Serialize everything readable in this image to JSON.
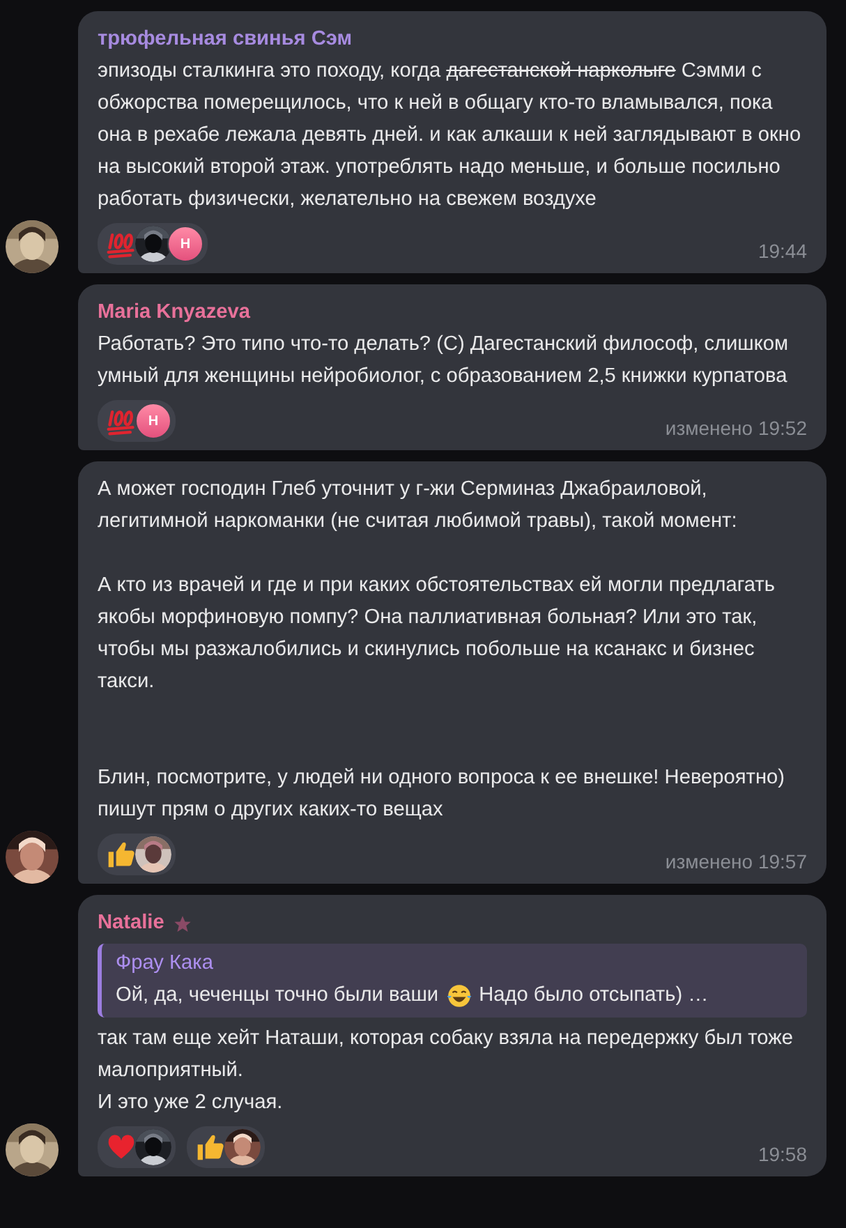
{
  "messages": [
    {
      "author": {
        "name": "трюфельная свинья Сэм",
        "color": "#a78be0",
        "premium": false
      },
      "avatar": {
        "kind": "picture"
      },
      "body": [
        {
          "text": "эпизоды сталкинга это походу, когда ",
          "struck": false
        },
        {
          "text": "дагестанской нарколыге",
          "struck": true
        },
        {
          "text": " Сэмми с обжорства померещилось, что к ней в общагу кто-то вламывался, пока она в рехабе лежала девять дней. и как алкаши к ней заглядывают в окно на высокий второй этаж. употреблять надо меньше, и больше посильно работать физически, желательно на свежем воздухе",
          "struck": false
        }
      ],
      "reactions": [
        {
          "kind": "hundred",
          "avatars": [
            {
              "kind": "picture"
            },
            {
              "kind": "initial",
              "text": "Н"
            }
          ]
        }
      ],
      "time": "19:44"
    },
    {
      "author": {
        "name": "Maria Knyazeva",
        "color": "#e8719a",
        "premium": false
      },
      "body": [
        {
          "text": "Работать? Это типо что-то делать? (С) Дагестанский философ, слишком умный для женщины нейробиолог, с образованием 2,5 книжки курпатова",
          "struck": false
        }
      ],
      "reactions": [
        {
          "kind": "hundred",
          "avatars": [
            {
              "kind": "initial",
              "text": "Н"
            }
          ]
        }
      ],
      "time": "изменено 19:52"
    },
    {
      "avatar": {
        "kind": "picture"
      },
      "body": [
        {
          "text": "А может господин Глеб уточнит у г-жи Серминаз Джабраиловой, легитимной наркоманки (не считая любимой травы), такой момент:\n\nА кто из врачей и где и при каких обстоятельствах ей могли предлагать якобы морфиновую помпу? Она паллиативная больная? Или это так, чтобы мы разжалобились и скинулись побольше на ксанакс и бизнес такси.\n\n\nБлин, посмотрите, у людей ни одного вопроса к ее внешке! Невероятно) пишут прям о других каких-то вещах",
          "struck": false
        }
      ],
      "reactions": [
        {
          "kind": "thumbs-up",
          "avatars": [
            {
              "kind": "picture"
            }
          ]
        }
      ],
      "time": "изменено 19:57"
    },
    {
      "author": {
        "name": "Natalie",
        "color": "#e8719a",
        "premium": true
      },
      "avatar": {
        "kind": "picture"
      },
      "reply": {
        "author": "Фрау Кака",
        "text": [
          "Ой, да, чеченцы точно были ваши",
          "Надо было отсыпать) …"
        ]
      },
      "body": [
        {
          "text": "так там еще хейт Наташи, которая собаку взяла на передержку был тоже малоприятный.\nИ это уже 2 случая.",
          "struck": false
        }
      ],
      "reactions": [
        {
          "kind": "heart",
          "avatars": [
            {
              "kind": "picture"
            }
          ]
        },
        {
          "kind": "thumbs-up",
          "avatars": [
            {
              "kind": "picture"
            }
          ]
        }
      ],
      "time": "19:58"
    }
  ]
}
